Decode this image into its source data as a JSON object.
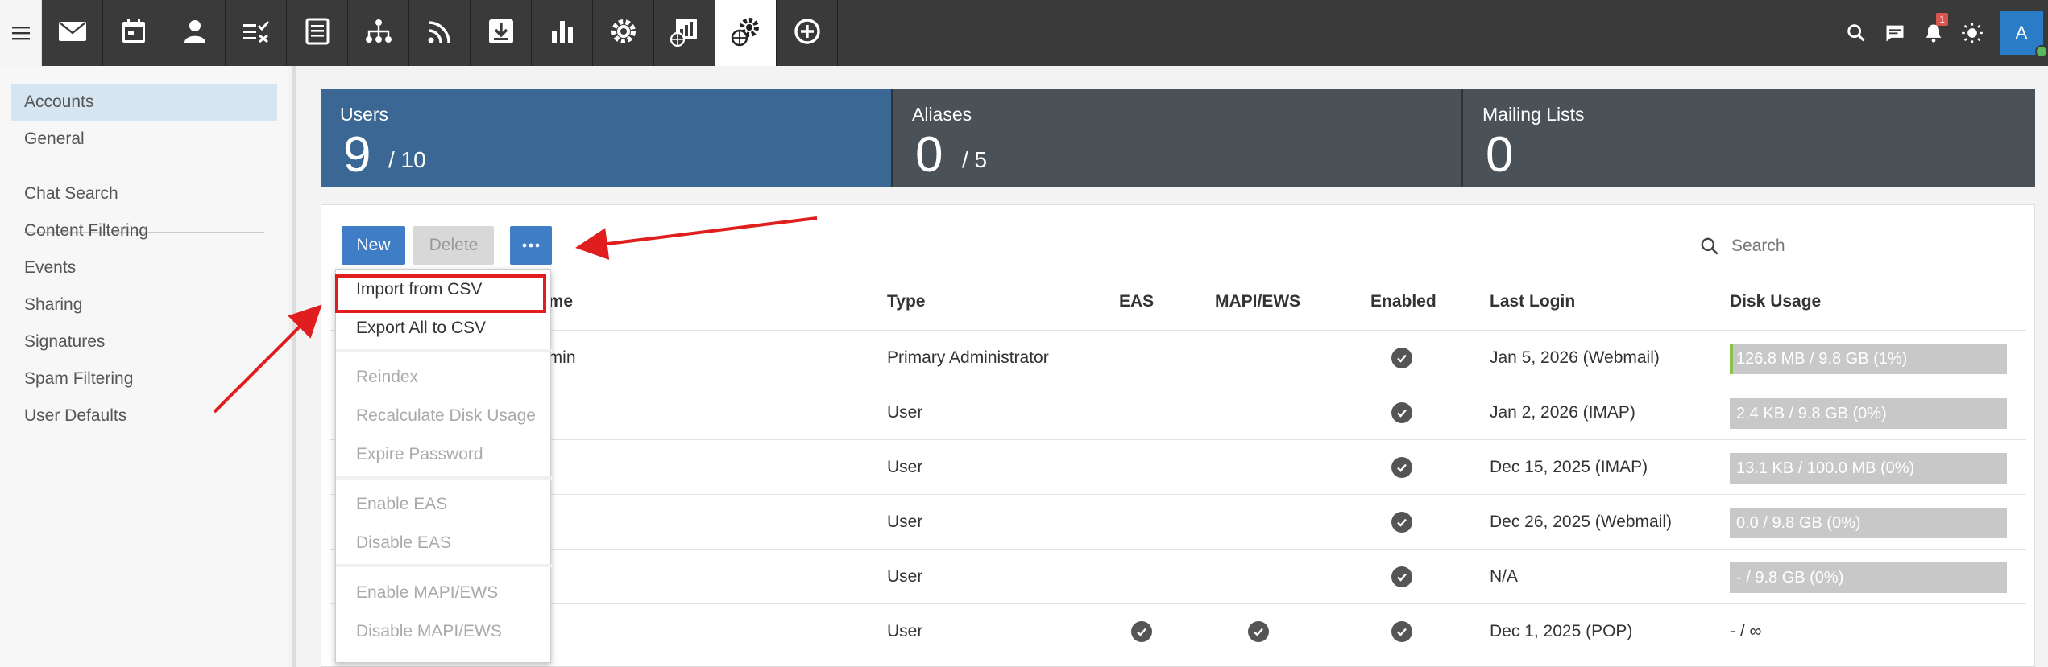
{
  "topbar": {
    "apps": [
      {
        "icon": "mail-icon",
        "name": "app-tab-mail"
      },
      {
        "icon": "calendar-icon",
        "name": "app-tab-calendar"
      },
      {
        "icon": "contacts-icon",
        "name": "app-tab-contacts"
      },
      {
        "icon": "tasks-icon",
        "name": "app-tab-tasks"
      },
      {
        "icon": "notes-icon",
        "name": "app-tab-notes"
      },
      {
        "icon": "org-chart-icon",
        "name": "app-tab-org-chart"
      },
      {
        "icon": "rss-icon",
        "name": "app-tab-rss"
      },
      {
        "icon": "download-icon",
        "name": "app-tab-file-storage"
      },
      {
        "icon": "bar-chart-icon",
        "name": "app-tab-reports"
      },
      {
        "icon": "gear-icon",
        "name": "app-tab-settings"
      },
      {
        "icon": "report-globe-icon",
        "name": "app-tab-system-reports"
      },
      {
        "icon": "domain-settings-icon",
        "name": "app-tab-domain-settings"
      },
      {
        "icon": "add-circle-icon",
        "name": "app-tab-add"
      }
    ],
    "notification_count": "1",
    "avatar_letter": "A"
  },
  "sidebar": {
    "items": [
      {
        "label": "Accounts",
        "active": true
      },
      {
        "label": "General"
      },
      {
        "label": "Chat Search"
      },
      {
        "label": "Content Filtering"
      },
      {
        "label": "Events"
      },
      {
        "label": "Sharing"
      },
      {
        "label": "Signatures"
      },
      {
        "label": "Spam Filtering"
      },
      {
        "label": "User Defaults"
      }
    ]
  },
  "stats": {
    "users": {
      "label": "Users",
      "value": "9",
      "total": "/ 10"
    },
    "aliases": {
      "label": "Aliases",
      "value": "0",
      "total": "/ 5"
    },
    "lists": {
      "label": "Mailing Lists",
      "value": "0"
    }
  },
  "toolbar": {
    "new_label": "New",
    "delete_label": "Delete",
    "search_placeholder": "Search"
  },
  "dropdown": {
    "items": [
      {
        "label": "Import from CSV",
        "enabled": true
      },
      {
        "label": "Export All to CSV",
        "enabled": true
      },
      {
        "label": "Reindex",
        "enabled": false
      },
      {
        "label": "Recalculate Disk Usage",
        "enabled": false
      },
      {
        "label": "Expire Password",
        "enabled": false
      },
      {
        "label": "Enable EAS",
        "enabled": false
      },
      {
        "label": "Disable EAS",
        "enabled": false
      },
      {
        "label": "Enable MAPI/EWS",
        "enabled": false
      },
      {
        "label": "Disable MAPI/EWS",
        "enabled": false
      }
    ]
  },
  "table": {
    "headers": [
      "Name",
      "Type",
      "EAS",
      "MAPI/EWS",
      "Enabled",
      "Last Login",
      "Disk Usage"
    ],
    "header_name_visible": "ame",
    "rows": [
      {
        "name": "dmin",
        "type": "Primary Administrator",
        "eas": false,
        "mapi": false,
        "enabled": true,
        "last_login": "Jan 5, 2026 (Webmail)",
        "disk": "126.8 MB / 9.8 GB (1%)",
        "disk_pct": 1,
        "disk_bar": true
      },
      {
        "name": "",
        "type": "User",
        "eas": false,
        "mapi": false,
        "enabled": true,
        "last_login": "Jan 2, 2026 (IMAP)",
        "disk": "2.4 KB / 9.8 GB (0%)",
        "disk_pct": 0,
        "disk_bar": true
      },
      {
        "name": "",
        "type": "User",
        "eas": false,
        "mapi": false,
        "enabled": true,
        "last_login": "Dec 15, 2025 (IMAP)",
        "disk": "13.1 KB / 100.0 MB (0%)",
        "disk_pct": 0,
        "disk_bar": true
      },
      {
        "name": "",
        "type": "User",
        "eas": false,
        "mapi": false,
        "enabled": true,
        "last_login": "Dec 26, 2025 (Webmail)",
        "disk": "0.0 / 9.8 GB (0%)",
        "disk_pct": 0,
        "disk_bar": true
      },
      {
        "name": "",
        "type": "User",
        "eas": false,
        "mapi": false,
        "enabled": true,
        "last_login": "N/A",
        "disk": "- / 9.8 GB (0%)",
        "disk_pct": 0,
        "disk_bar": true
      },
      {
        "name": "",
        "type": "User",
        "eas": true,
        "mapi": true,
        "enabled": true,
        "last_login": "Dec 1, 2025 (POP)",
        "disk": "- / ∞",
        "disk_pct": 0,
        "disk_bar": false
      }
    ]
  },
  "colors": {
    "users_tile": "#3a6794",
    "other_tiles": "#4a5157",
    "primary_button": "#3f7dc6",
    "annotation_red": "#e01e1e",
    "disk_fill": "#8bc34a"
  }
}
